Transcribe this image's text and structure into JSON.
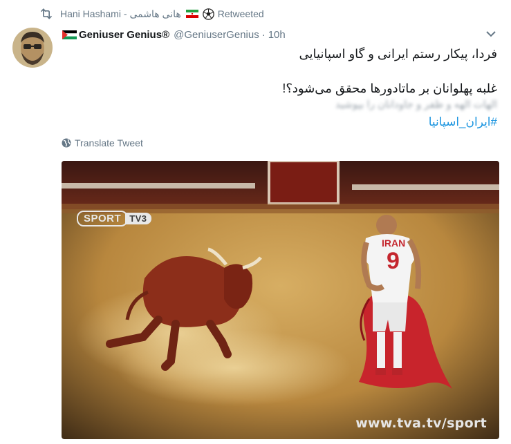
{
  "retweet": {
    "label": "Retweeted",
    "name_en": "Hani Hashami -",
    "name_fa": "هانی هاشمی"
  },
  "tweet": {
    "display_name": "Geniuser Genius®",
    "handle": "@GeniuserGenius",
    "separator": "·",
    "time": "10h",
    "line1": "فردا، پیکار رستم ایرانی و گاو اسپانیایی",
    "line2": "غلبه پهلوانان بر ماتادورها محقق می‌شود؟!",
    "blurred_line": "الهات الهه و ظفر و جاودانان را بپوشید",
    "hashtag": "#ایران_اسپانیا",
    "translate_label": "Translate Tweet"
  },
  "media": {
    "logo_sport": "SPORT",
    "logo_tv": "TV3",
    "watermark": "www.tva.tv/sport",
    "jersey_word": "IRAN",
    "jersey_number": "9"
  },
  "colors": {
    "link": "#1b95e0",
    "muted": "#657786",
    "text": "#14171a"
  }
}
